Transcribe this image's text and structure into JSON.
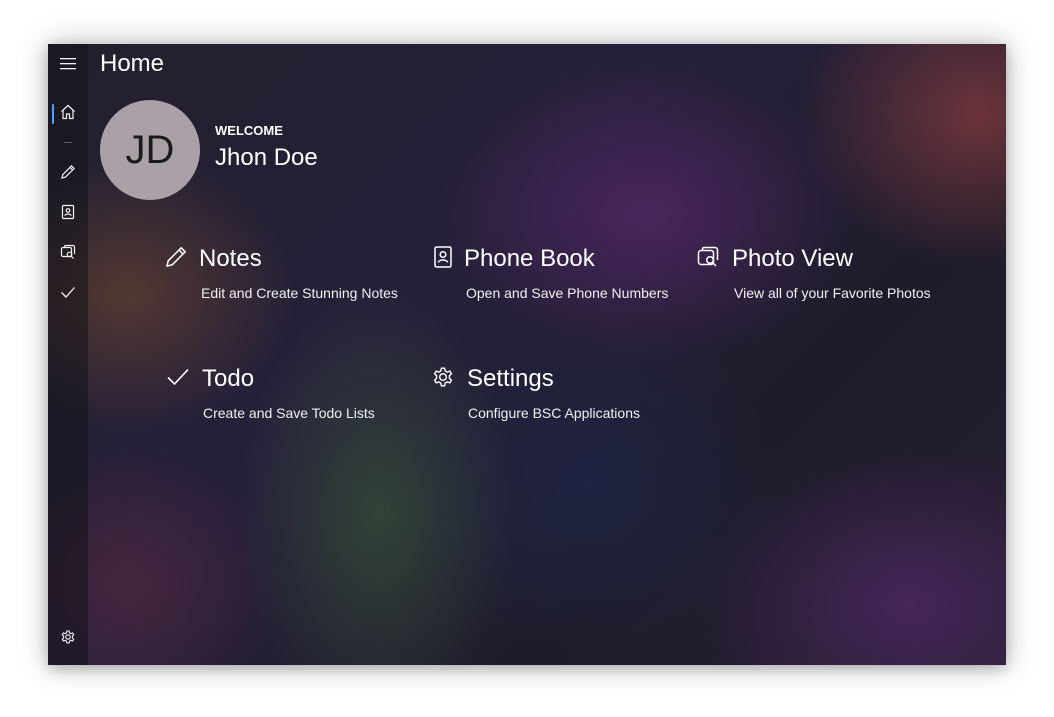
{
  "page": {
    "title": "Home"
  },
  "profile": {
    "initials": "JD",
    "welcome_label": "WELCOME",
    "name": "Jhon Doe"
  },
  "nav": {
    "items": [
      {
        "name": "menu",
        "icon": "hamburger-icon"
      },
      {
        "name": "home",
        "icon": "home-icon",
        "selected": true
      },
      {
        "name": "notes",
        "icon": "pencil-icon"
      },
      {
        "name": "phone-book",
        "icon": "contact-book-icon"
      },
      {
        "name": "photo-view",
        "icon": "photos-icon"
      },
      {
        "name": "todo",
        "icon": "checkmark-icon"
      }
    ],
    "footer": {
      "name": "settings",
      "icon": "gear-icon"
    },
    "accent": "#4aa3ff"
  },
  "tiles": [
    {
      "title": "Notes",
      "description": "Edit and Create Stunning Notes",
      "icon": "pencil-icon"
    },
    {
      "title": "Phone Book",
      "description": "Open and Save Phone Numbers",
      "icon": "contact-book-icon"
    },
    {
      "title": "Photo View",
      "description": "View all of your Favorite Photos",
      "icon": "photos-icon"
    },
    {
      "title": "Todo",
      "description": "Create and Save Todo Lists",
      "icon": "checkmark-icon"
    },
    {
      "title": "Settings",
      "description": "Configure BSC Applications",
      "icon": "gear-icon"
    }
  ]
}
